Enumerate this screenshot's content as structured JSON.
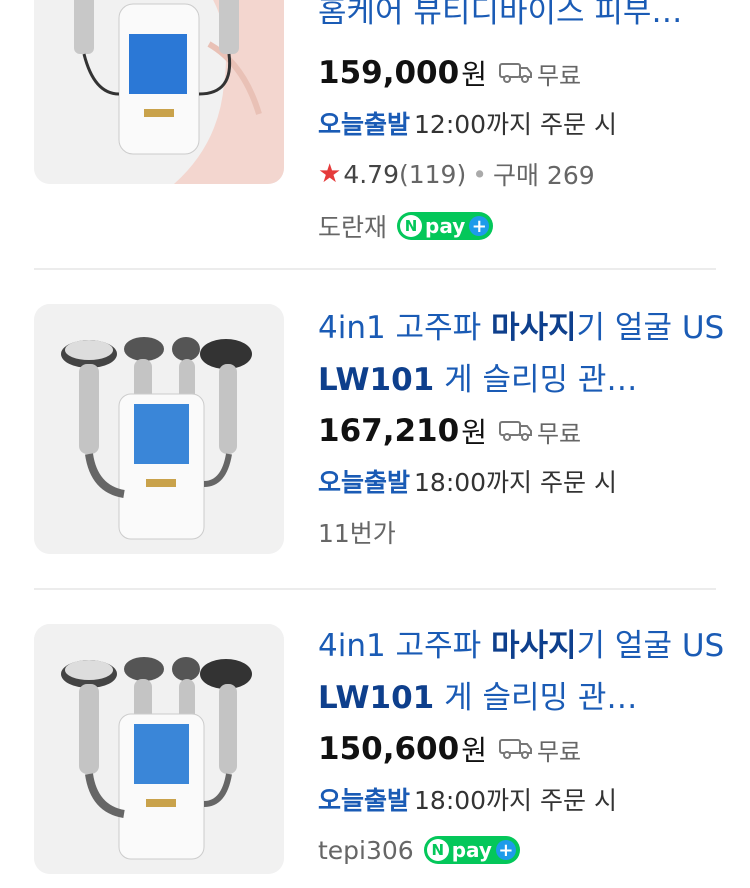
{
  "products": [
    {
      "title": "홈케어 뷰티디바이스 피부…",
      "title_parts": [],
      "price": "159,000",
      "currency": "원",
      "shipping": "무료",
      "delivery_label": "오늘출발",
      "delivery_text": "12:00까지 주문 시",
      "rating": "4.79",
      "review_count": "(119)",
      "purchase": "구매 269",
      "seller": "도란재",
      "npay": true
    },
    {
      "title_parts": [
        "4in1 고주파 ",
        "마사지",
        "기 얼굴 US ",
        "LW101",
        " 게 슬리밍 관…"
      ],
      "price": "167,210",
      "currency": "원",
      "shipping": "무료",
      "delivery_label": "오늘출발",
      "delivery_text": "18:00까지 주문 시",
      "seller": "11번가",
      "npay": false
    },
    {
      "title_parts": [
        "4in1 고주파 ",
        "마사지",
        "기 얼굴 US ",
        "LW101",
        " 게 슬리밍 관…"
      ],
      "price": "150,600",
      "currency": "원",
      "shipping": "무료",
      "delivery_label": "오늘출발",
      "delivery_text": "18:00까지 주문 시",
      "seller": "tepi306",
      "npay": true
    }
  ],
  "npay_badge": {
    "n": "N",
    "text": "pay",
    "plus": "+"
  },
  "colors": {
    "title": "#1a5bb5",
    "highlight": "#0e3f8c",
    "star": "#e53b3b",
    "npay": "#04c75a"
  },
  "icons": [
    "truck-icon",
    "star-icon",
    "npay-logo"
  ]
}
